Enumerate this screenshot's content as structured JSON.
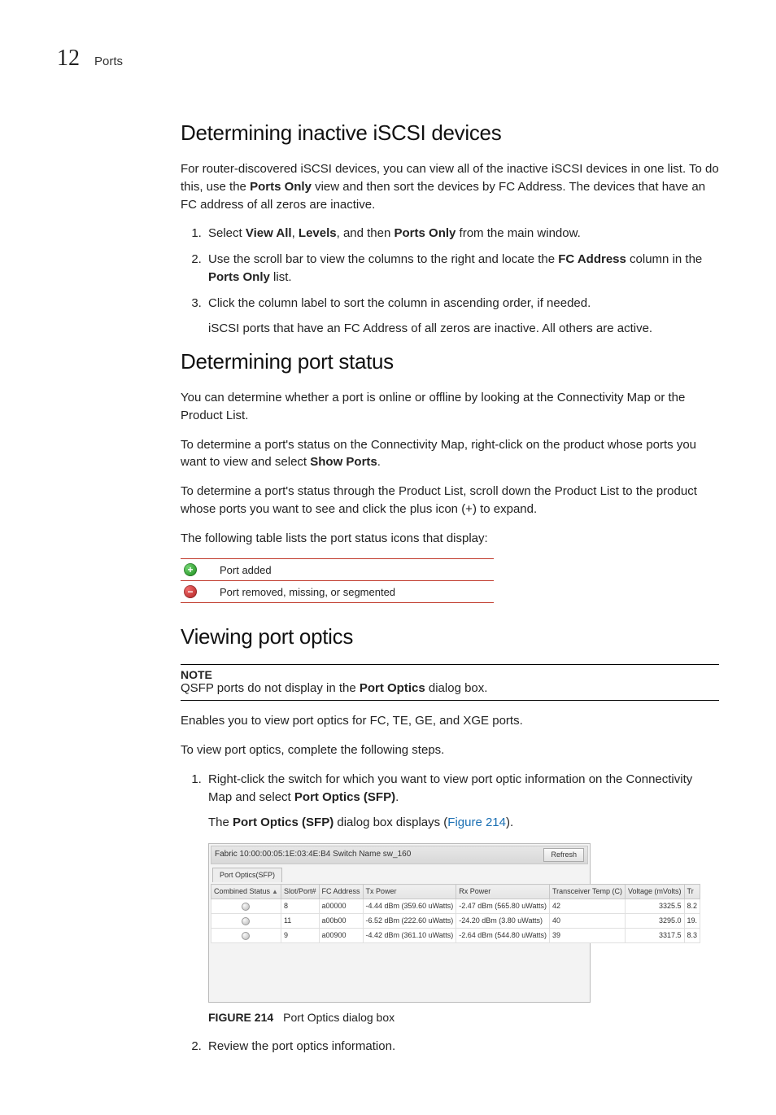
{
  "header": {
    "chapter_number": "12",
    "chapter_title": "Ports"
  },
  "s1": {
    "heading": "Determining inactive iSCSI devices",
    "intro_a": "For router-discovered iSCSI devices, you can view all of the inactive iSCSI devices in one list. To do this, use the ",
    "intro_b": " view and then sort the devices by FC Address. The devices that have an FC address of all zeros are inactive.",
    "ports_only": "Ports Only",
    "step1_a": "Select ",
    "view_all": "View All",
    "step1_b": ", ",
    "levels": "Levels",
    "step1_c": ", and then ",
    "step1_d": " from the main window.",
    "step2_a": "Use the scroll bar to view the columns to the right and locate the ",
    "fc_address": "FC Address",
    "step2_b": " column in the ",
    "step2_c": " list.",
    "step3": "Click the column label to sort the column in ascending order, if needed.",
    "step3_sub": "iSCSI ports that have an FC Address of all zeros are inactive. All others are active."
  },
  "s2": {
    "heading": "Determining port status",
    "p1": "You can determine whether a port is online or offline by looking at the Connectivity Map or the Product List.",
    "p2_a": "To determine a port's status on the Connectivity Map, right-click on the product whose ports you want to view and select ",
    "show_ports": "Show Ports",
    "p2_b": ".",
    "p3": "To determine a port's status through the Product List, scroll down the Product List to the product whose ports you want to see and click the plus icon (+) to expand.",
    "p4": "The following table lists the port status icons that display:",
    "row1": "Port added",
    "row2": "Port removed, missing, or segmented"
  },
  "s3": {
    "heading": "Viewing port optics",
    "note_label": "NOTE",
    "note_a": "QSFP ports do not display in the ",
    "port_optics": "Port Optics",
    "note_b": " dialog box.",
    "p1": "Enables you to view port optics for FC, TE, GE, and XGE ports.",
    "p2": "To view port optics, complete the following steps.",
    "step1_a": "Right-click the switch for which you want to view port optic information on the Connectivity Map and select ",
    "port_optics_sfp": "Port Optics (SFP)",
    "step1_b": ".",
    "step1_sub_a": "The ",
    "step1_sub_b": " dialog box displays (",
    "fig_ref": "Figure 214",
    "step1_sub_c": ").",
    "fig_caption_a": "FIGURE 214",
    "fig_caption_b": "Port Optics dialog box",
    "step2": "Review the port optics information."
  },
  "screenshot": {
    "top_a": "Fabric 10:00:00:05:1E:03:4E:B4    Switch Name sw_160",
    "refresh": "Refresh",
    "tab": "Port Optics(SFP)",
    "cols": {
      "c1": "Combined Status",
      "c2": "Slot/Port#",
      "c3": "FC Address",
      "c4": "Tx Power",
      "c5": "Rx Power",
      "c6": "Transceiver Temp (C)",
      "c7": "Voltage (mVolts)",
      "c8": "Tr"
    },
    "rows": [
      {
        "slot": "8",
        "fc": "a00000",
        "tx": "-4.44 dBm (359.60 uWatts)",
        "rx": "-2.47 dBm (565.80 uWatts)",
        "temp": "42",
        "volt": "3325.5",
        "last": "8.2"
      },
      {
        "slot": "11",
        "fc": "a00b00",
        "tx": "-6.52 dBm (222.60 uWatts)",
        "rx": "-24.20 dBm (3.80 uWatts)",
        "temp": "40",
        "volt": "3295.0",
        "last": "19."
      },
      {
        "slot": "9",
        "fc": "a00900",
        "tx": "-4.42 dBm (361.10 uWatts)",
        "rx": "-2.64 dBm (544.80 uWatts)",
        "temp": "39",
        "volt": "3317.5",
        "last": "8.3"
      }
    ]
  }
}
